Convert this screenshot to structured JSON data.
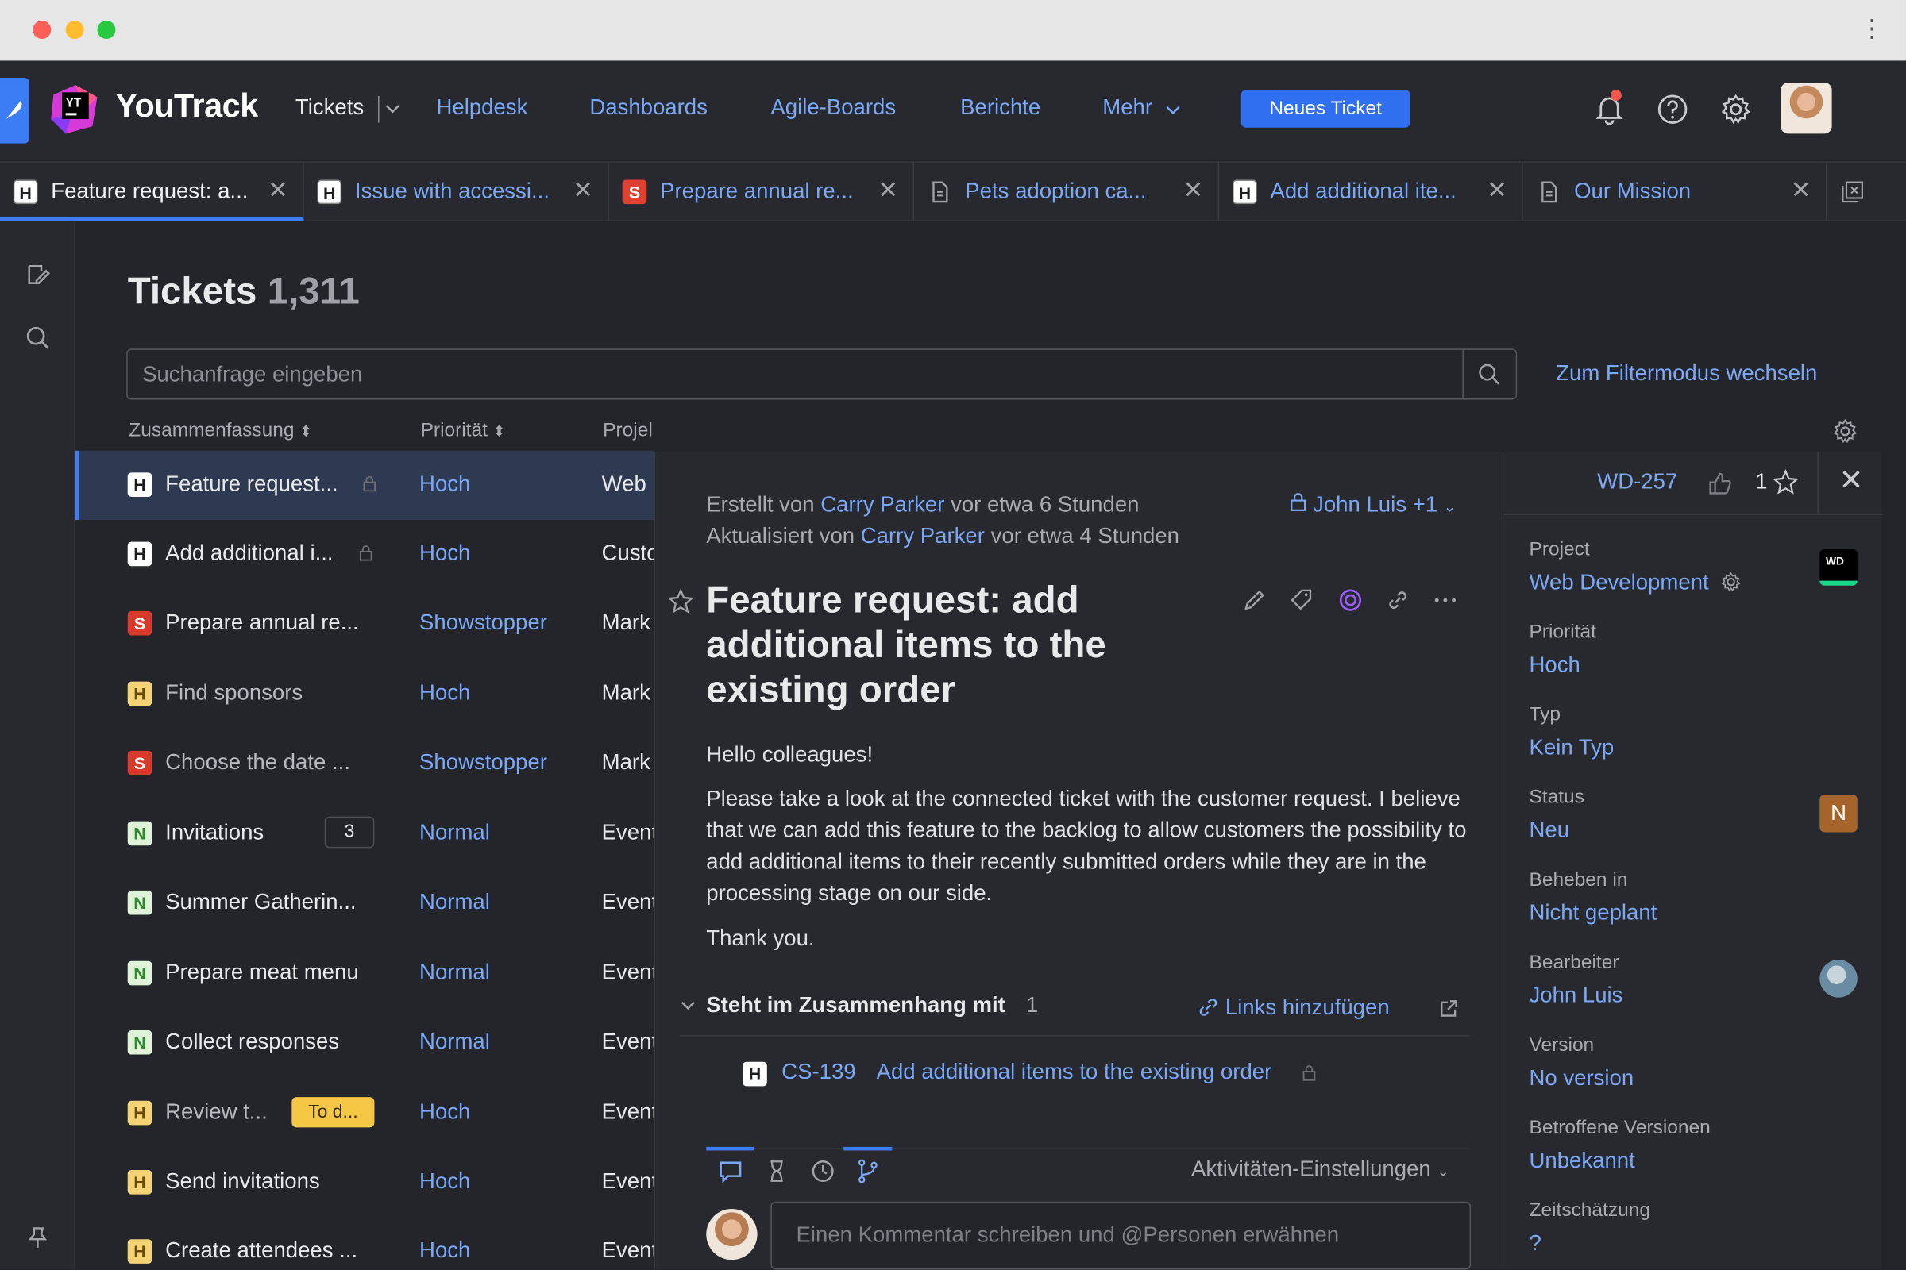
{
  "header": {
    "brand": "YouTrack",
    "nav": [
      "Tickets",
      "Helpdesk",
      "Dashboards",
      "Agile-Boards",
      "Berichte",
      "Mehr"
    ],
    "new_ticket": "Neues Ticket"
  },
  "tabs": [
    {
      "label": "Feature request: a...",
      "icon": "H",
      "type": "h"
    },
    {
      "label": "Issue with accessi...",
      "icon": "H",
      "type": "h"
    },
    {
      "label": "Prepare annual re...",
      "icon": "S",
      "type": "s"
    },
    {
      "label": "Pets adoption ca...",
      "icon": "doc",
      "type": "doc"
    },
    {
      "label": "Add additional ite...",
      "icon": "H",
      "type": "h"
    },
    {
      "label": "Our Mission",
      "icon": "doc",
      "type": "doc"
    }
  ],
  "list": {
    "title": "Tickets",
    "count": "1,311",
    "search_placeholder": "Suchanfrage eingeben",
    "filter_link": "Zum Filtermodus wechseln",
    "columns": [
      "Zusammenfassung",
      "Priorität",
      "Projel"
    ],
    "rows": [
      {
        "icon": "H",
        "summary": "Feature request...",
        "priority": "Hoch",
        "project": "Web"
      },
      {
        "icon": "H",
        "summary": "Add additional i...",
        "priority": "Hoch",
        "project": "Custo"
      },
      {
        "icon": "S",
        "summary": "Prepare annual re...",
        "priority": "Showstopper",
        "project": "Mark"
      },
      {
        "icon": "H",
        "summary": "Find sponsors",
        "priority": "Hoch",
        "project": "Mark"
      },
      {
        "icon": "S",
        "summary": "Choose the date ...",
        "priority": "Showstopper",
        "project": "Mark"
      },
      {
        "icon": "N",
        "summary": "Invitations",
        "priority": "Normal",
        "project": "Event",
        "badge": "3"
      },
      {
        "icon": "N",
        "summary": "Summer Gatherin...",
        "priority": "Normal",
        "project": "Event"
      },
      {
        "icon": "N",
        "summary": "Prepare meat menu",
        "priority": "Normal",
        "project": "Event"
      },
      {
        "icon": "N",
        "summary": "Collect responses",
        "priority": "Normal",
        "project": "Event"
      },
      {
        "icon": "H",
        "summary": "Review t...",
        "priority": "Hoch",
        "project": "Event",
        "tag": "To d..."
      },
      {
        "icon": "H",
        "summary": "Send invitations",
        "priority": "Hoch",
        "project": "Event"
      },
      {
        "icon": "H",
        "summary": "Create attendees ...",
        "priority": "Hoch",
        "project": "Event"
      }
    ]
  },
  "detail": {
    "created_prefix": "Erstellt von",
    "created_by": "Carry Parker",
    "created_when": "vor etwa 6 Stunden",
    "updated_prefix": "Aktualisiert von",
    "updated_by": "Carry Parker",
    "updated_when": "vor etwa 4 Stunden",
    "visibility": "John Luis +1",
    "title": "Feature request: add additional items to the existing order",
    "greeting": "Hello colleagues!",
    "body": "Please take a look at the connected ticket with the customer request. I believe that we can add this feature to the backlog to allow customers the possibility to add additional items to their recently submitted orders while they are in the processing stage on our side.",
    "closing": "Thank you.",
    "links_title": "Steht im Zusammenhang mit",
    "links_count": "1",
    "add_links": "Links hinzufügen",
    "linked": {
      "id": "CS-139",
      "summary": "Add additional items to the existing order"
    },
    "activity_settings": "Aktivitäten-Einstellungen",
    "comment_placeholder": "Einen Kommentar schreiben und @Personen erwähnen"
  },
  "fields": {
    "id": "WD-257",
    "votes": "1",
    "project_logo": "WD",
    "items": [
      {
        "label": "Project",
        "value": "Web Development"
      },
      {
        "label": "Priorität",
        "value": "Hoch"
      },
      {
        "label": "Typ",
        "value": "Kein Typ"
      },
      {
        "label": "Status",
        "value": "Neu",
        "badge": "N"
      },
      {
        "label": "Beheben in",
        "value": "Nicht geplant"
      },
      {
        "label": "Bearbeiter",
        "value": "John Luis"
      },
      {
        "label": "Version",
        "value": "No version"
      },
      {
        "label": "Betroffene Versionen",
        "value": "Unbekannt"
      },
      {
        "label": "Zeitschätzung",
        "value": "?"
      }
    ]
  },
  "colors": {
    "accent": "#3c7df5",
    "link": "#7aa8f7",
    "background": "#23252b",
    "panel": "#27292e"
  }
}
